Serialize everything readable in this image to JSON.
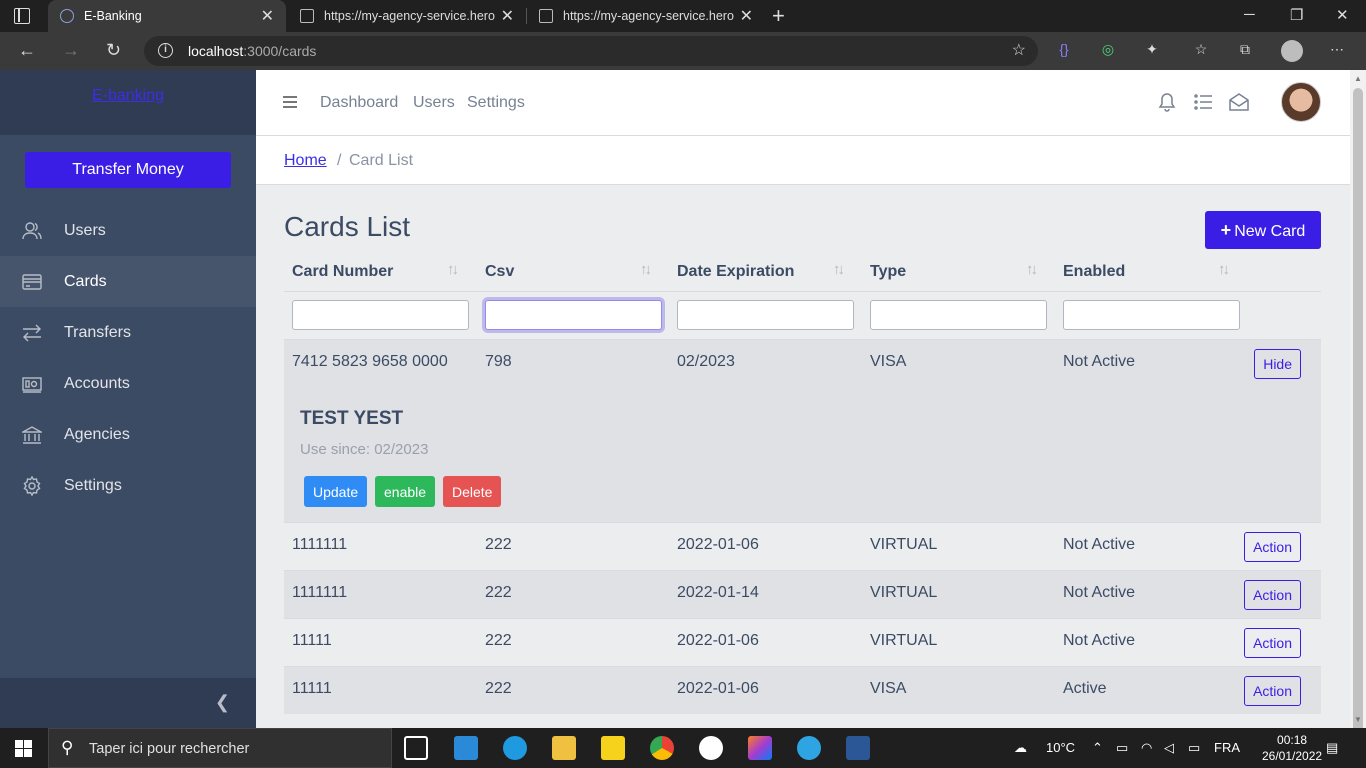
{
  "browser": {
    "tabs": [
      {
        "title": "E-Banking",
        "active": true
      },
      {
        "title": "https://my-agency-service.herok",
        "active": false
      },
      {
        "title": "https://my-agency-service.herok",
        "active": false
      }
    ],
    "url_host": "localhost",
    "url_path": ":3000/cards"
  },
  "sidebar": {
    "brand": "E-banking",
    "transfer_button": "Transfer Money",
    "items": [
      {
        "label": "Users",
        "icon": "users-icon",
        "active": false
      },
      {
        "label": "Cards",
        "icon": "credit-card-icon",
        "active": true
      },
      {
        "label": "Transfers",
        "icon": "transfer-arrows-icon",
        "active": false
      },
      {
        "label": "Accounts",
        "icon": "money-icon",
        "active": false
      },
      {
        "label": "Agencies",
        "icon": "bank-icon",
        "active": false
      },
      {
        "label": "Settings",
        "icon": "gear-icon",
        "active": false
      }
    ]
  },
  "header": {
    "nav": [
      "Dashboard",
      "Users",
      "Settings"
    ]
  },
  "breadcrumb": {
    "home": "Home",
    "separator": "/",
    "current": "Card List"
  },
  "page": {
    "title": "Cards List",
    "new_button": "New Card"
  },
  "table": {
    "columns": [
      "Card Number",
      "Csv",
      "Date Expiration",
      "Type",
      "Enabled"
    ],
    "rows": [
      {
        "number": "7412 5823 9658 0000",
        "csv": "798",
        "expiration": "02/2023",
        "type": "VISA",
        "enabled": "Not Active",
        "button": "Hide"
      },
      {
        "number": "1111111",
        "csv": "222",
        "expiration": "2022-01-06",
        "type": "VIRTUAL",
        "enabled": "Not Active",
        "button": "Action"
      },
      {
        "number": "1111111",
        "csv": "222",
        "expiration": "2022-01-14",
        "type": "VIRTUAL",
        "enabled": "Not Active",
        "button": "Action"
      },
      {
        "number": "11111",
        "csv": "222",
        "expiration": "2022-01-06",
        "type": "VIRTUAL",
        "enabled": "Not Active",
        "button": "Action"
      },
      {
        "number": "11111",
        "csv": "222",
        "expiration": "2022-01-06",
        "type": "VISA",
        "enabled": "Active",
        "button": "Action"
      }
    ]
  },
  "details": {
    "name": "TEST YEST",
    "since": "Use since: 02/2023",
    "buttons": {
      "update": "Update",
      "enable": "enable",
      "delete": "Delete"
    }
  },
  "colors": {
    "primary": "#3b1ee6",
    "sidebar": "#3c4b64",
    "update": "#2f8cf5",
    "enable": "#2eb85c",
    "delete": "#e55353"
  },
  "taskbar": {
    "search_placeholder": "Taper ici pour rechercher",
    "weather": "10°C",
    "language": "FRA",
    "time": "00:18",
    "date": "26/01/2022"
  }
}
